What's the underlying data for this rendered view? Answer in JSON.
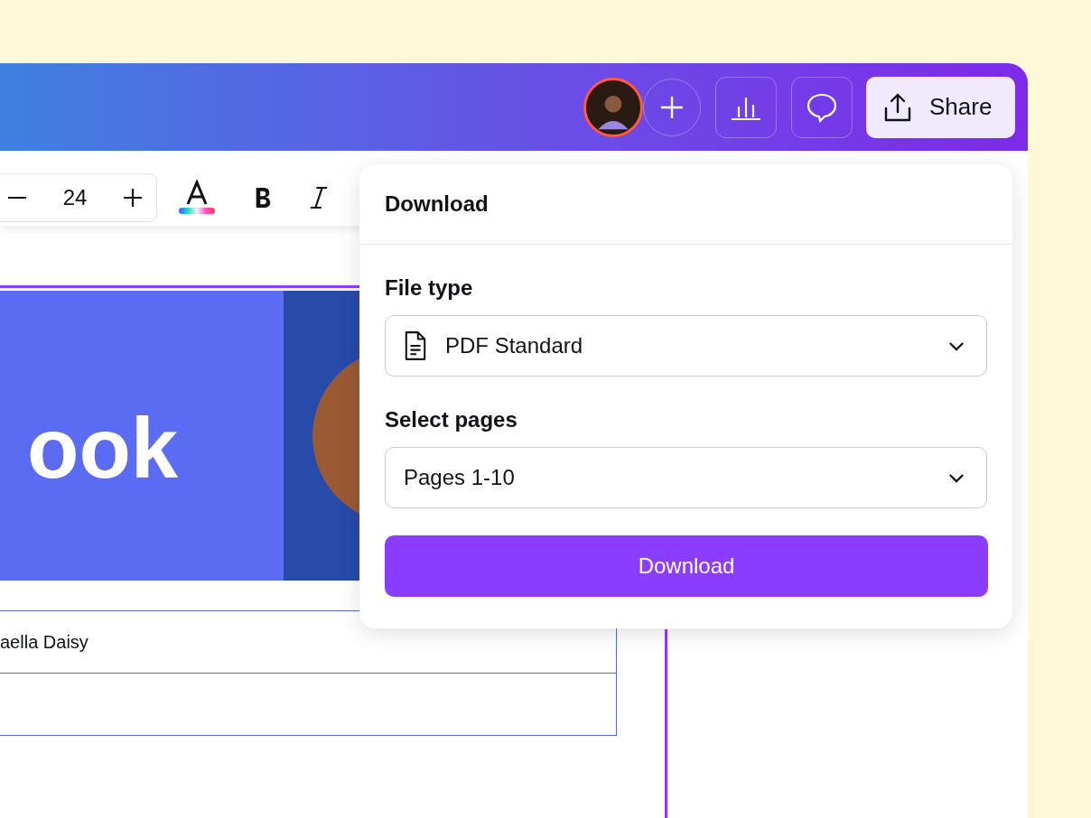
{
  "header": {
    "share_label": "Share"
  },
  "toolbar": {
    "font_size": "24"
  },
  "design": {
    "headline": "ook",
    "author": "aella Daisy"
  },
  "download_panel": {
    "title": "Download",
    "file_type": {
      "label": "File type",
      "value": "PDF Standard"
    },
    "pages": {
      "label": "Select pages",
      "value": "Pages 1-10"
    },
    "button": "Download"
  }
}
